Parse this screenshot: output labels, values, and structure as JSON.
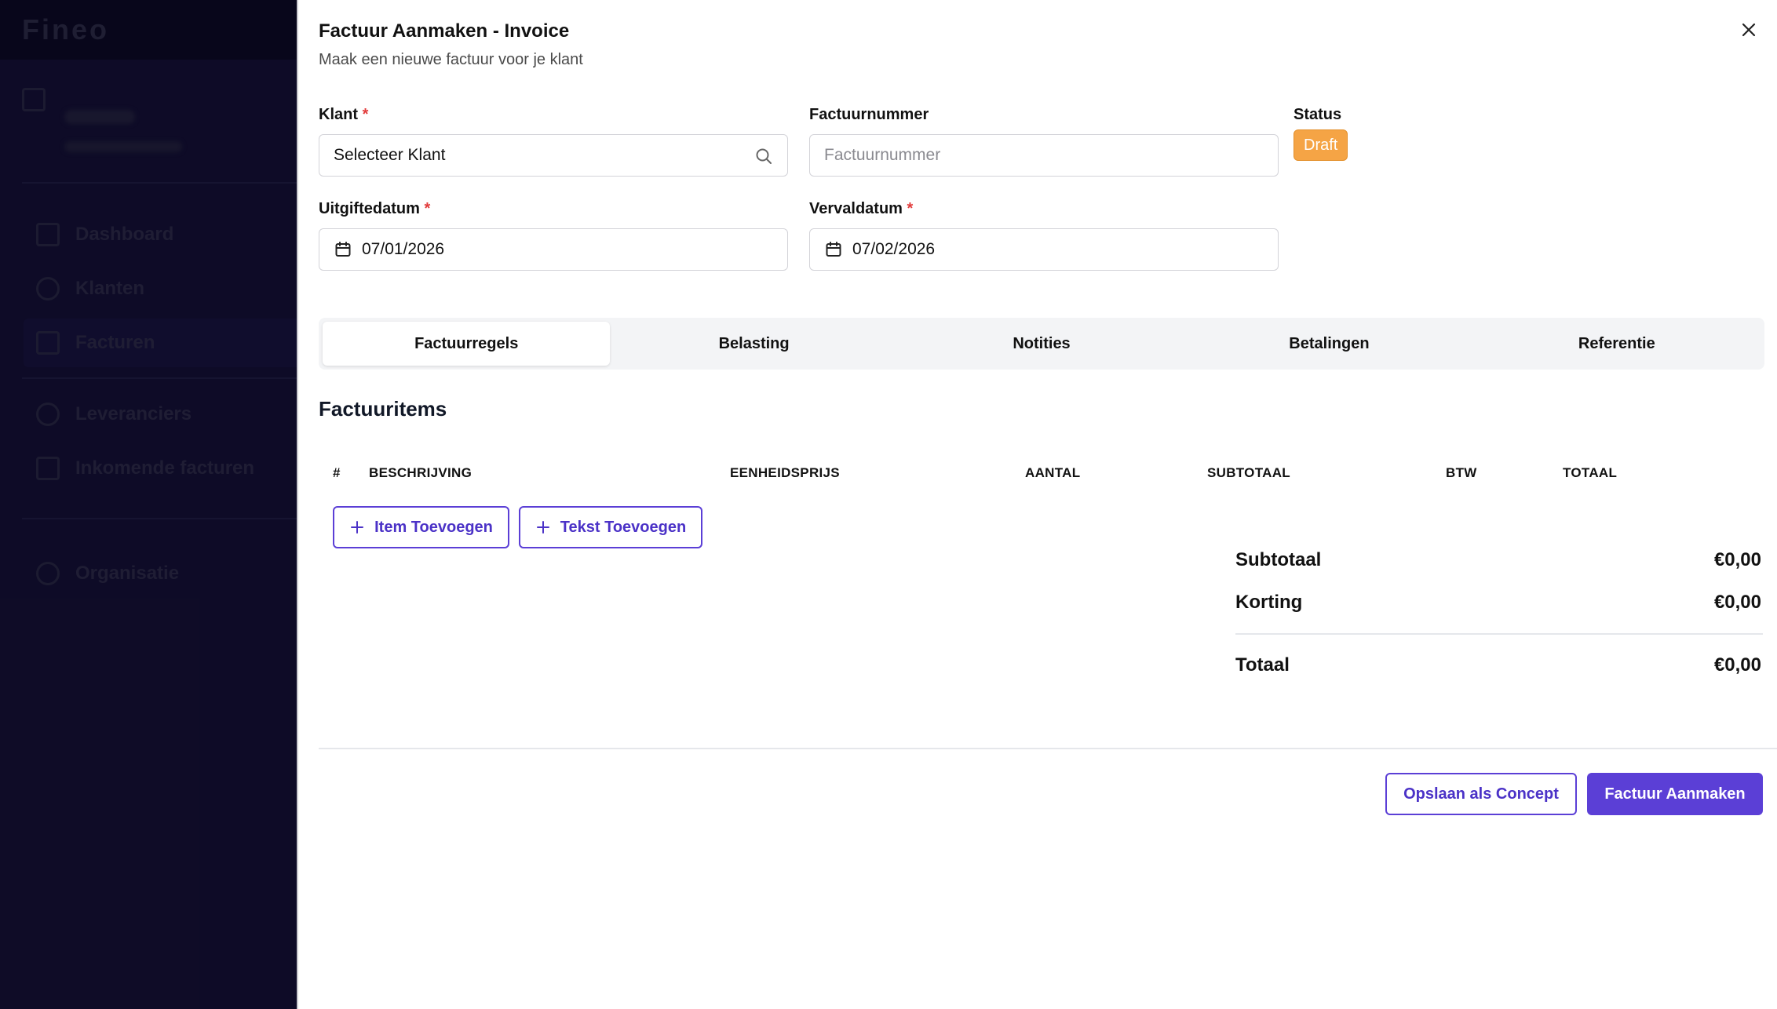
{
  "sidebar": {
    "brand": "Fineo",
    "items": [
      {
        "label": "Dashboard",
        "icon": "home-icon"
      },
      {
        "label": "Klanten",
        "icon": "users-icon"
      },
      {
        "label": "Facturen",
        "icon": "document-icon"
      },
      {
        "label": "Leveranciers",
        "icon": "users-icon"
      },
      {
        "label": "Inkomende facturen",
        "icon": "document-icon"
      },
      {
        "label": "Organisatie",
        "icon": "gear-icon"
      }
    ],
    "active_item": "Facturen"
  },
  "modal": {
    "title": "Factuur Aanmaken - Invoice",
    "subtitle": "Maak een nieuwe factuur voor je klant",
    "required_mark": "*"
  },
  "form": {
    "klant": {
      "label": "Klant",
      "value": "Selecteer Klant"
    },
    "factuurnummer": {
      "label": "Factuurnummer",
      "placeholder": "Factuurnummer"
    },
    "status": {
      "label": "Status",
      "value": "Draft"
    },
    "uitgiftedatum": {
      "label": "Uitgiftedatum",
      "value": "07/01/2026"
    },
    "vervaldatum": {
      "label": "Vervaldatum",
      "value": "07/02/2026"
    }
  },
  "tabs": [
    {
      "label": "Factuurregels",
      "active": true
    },
    {
      "label": "Belasting",
      "active": false
    },
    {
      "label": "Notities",
      "active": false
    },
    {
      "label": "Betalingen",
      "active": false
    },
    {
      "label": "Referentie",
      "active": false
    }
  ],
  "items_section": {
    "title": "Factuuritems",
    "columns": [
      "#",
      "BESCHRIJVING",
      "EENHEIDSPRIJS",
      "AANTAL",
      "SUBTOTAAL",
      "BTW",
      "TOTAAL"
    ],
    "add_item_label": "Item Toevoegen",
    "add_text_label": "Tekst Toevoegen"
  },
  "summary": {
    "subtotal_label": "Subtotaal",
    "subtotal_value": "€0,00",
    "discount_label": "Korting",
    "discount_value": "€0,00",
    "total_label": "Totaal",
    "total_value": "€0,00"
  },
  "footer": {
    "save_draft_label": "Opslaan als Concept",
    "create_label": "Factuur Aanmaken"
  },
  "colors": {
    "accent": "#5b3fd6",
    "status_draft": "#f5a445",
    "required": "#e23b3b"
  }
}
